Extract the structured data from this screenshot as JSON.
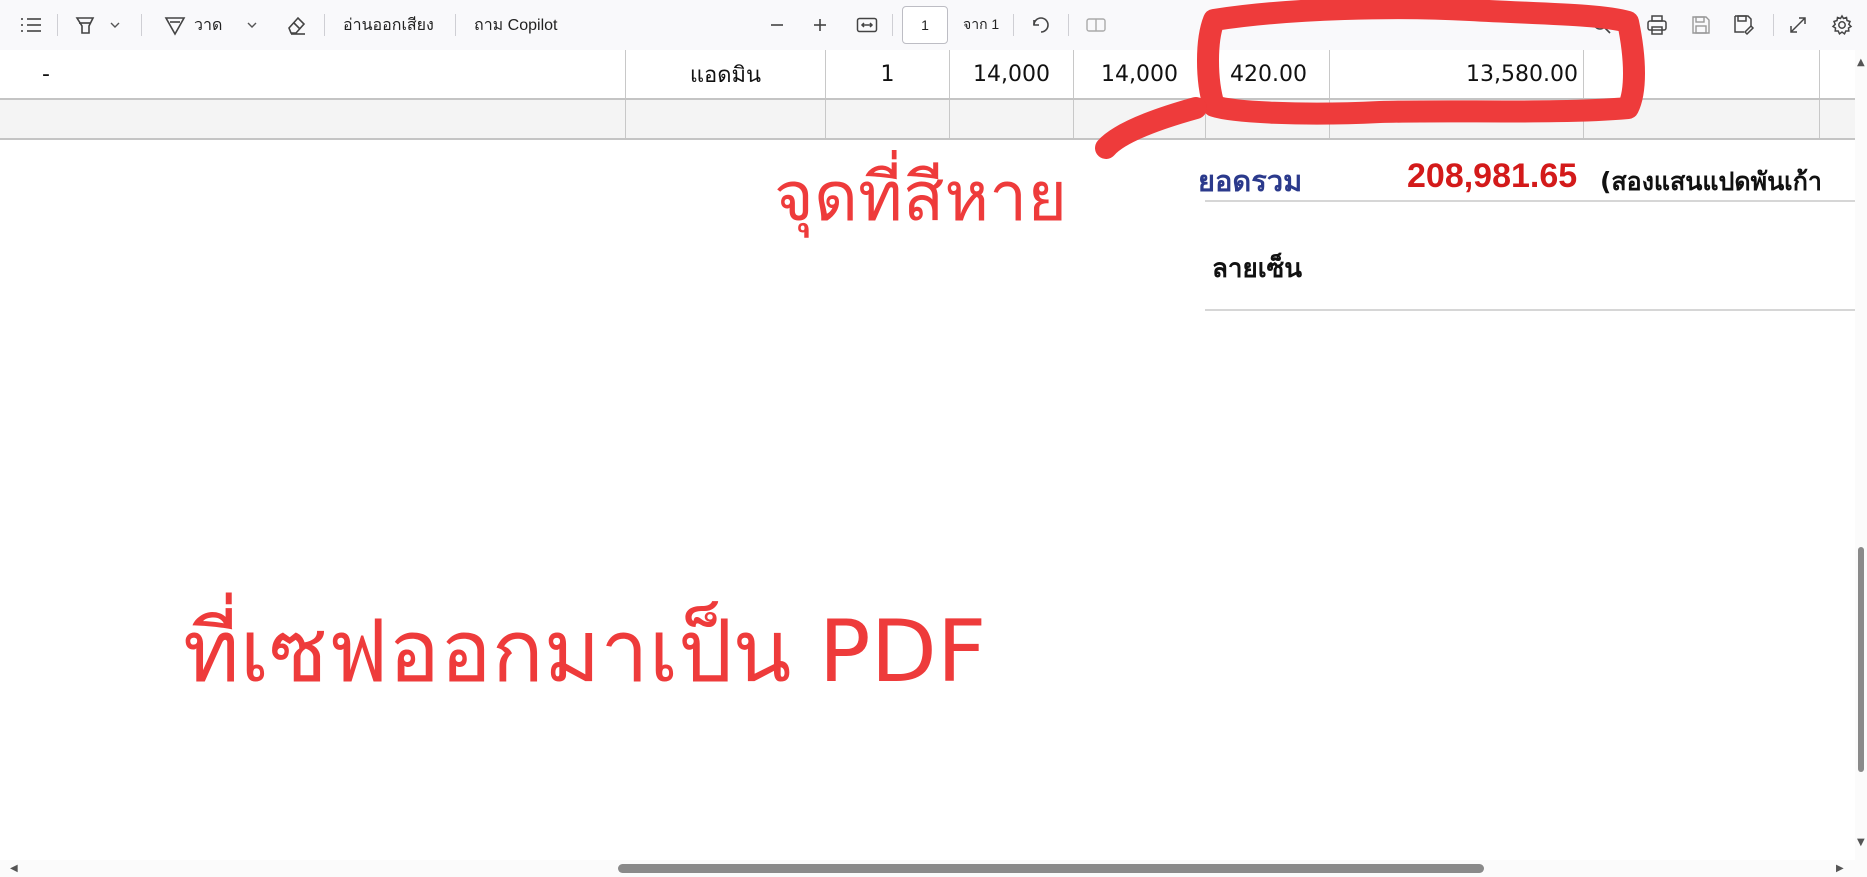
{
  "toolbar": {
    "draw_label": "วาด",
    "read_aloud_label": "อ่านออกเสียง",
    "ask_copilot_label": "ถาม Copilot",
    "page_number": "1",
    "page_of_label": "จาก 1"
  },
  "table": {
    "row": {
      "name": "-",
      "user": "แอดมิน",
      "qty": "1",
      "price": "14,000",
      "amount": "14,000",
      "discount": "420.00",
      "net": "13,580.00"
    }
  },
  "summary": {
    "total_label": "ยอดรวม",
    "total_value": "208,981.65",
    "total_words": "(สองแสนแปดพันเก้า",
    "signature_label": "ลายเซ็น"
  },
  "annotations": {
    "note_color_lost": "จุดที่สีหาย",
    "note_saved_pdf": "ที่เซฟออกมาเป็น PDF",
    "color": "#ee3b3b"
  },
  "colors": {
    "total_label": "#2b3a8c",
    "total_value": "#d31a1a"
  }
}
